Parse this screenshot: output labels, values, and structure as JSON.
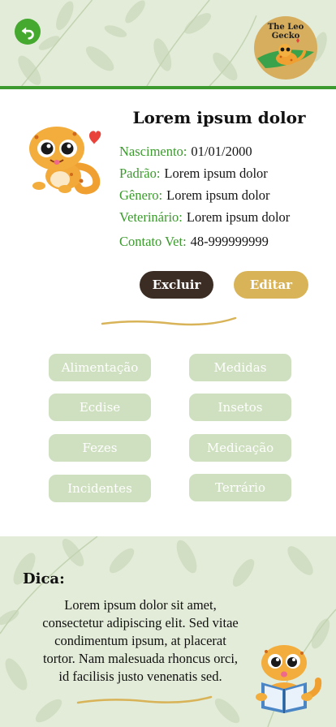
{
  "header": {
    "back_icon": "back-arrow-icon",
    "logo_text": "The Leo Gecko",
    "colors": {
      "header_bg": "#e3ecd8",
      "accent_green": "#3c9a2e",
      "logo_gold": "#d6ae5e"
    }
  },
  "profile": {
    "avatar_icon": "gecko-heart-icon",
    "name": "Lorem ipsum dolor",
    "fields": [
      {
        "label": "Nascimento:",
        "value": "01/01/2000"
      },
      {
        "label": "Padrão:",
        "value": "Lorem ipsum dolor"
      },
      {
        "label": "Gênero:",
        "value": "Lorem ipsum dolor"
      },
      {
        "label": "Veterinário:",
        "value": "Lorem ipsum dolor"
      },
      {
        "label": "Contato Vet:",
        "value": "48-999999999"
      }
    ]
  },
  "actions": {
    "delete_label": "Excluir",
    "edit_label": "Editar",
    "colors": {
      "delete_bg": "#3b2c24",
      "edit_bg": "#d8b358"
    }
  },
  "menu": {
    "items": [
      {
        "label": "Alimentação"
      },
      {
        "label": "Medidas"
      },
      {
        "label": "Ecdise"
      },
      {
        "label": "Insetos"
      },
      {
        "label": "Fezes"
      },
      {
        "label": "Medicação"
      },
      {
        "label": "Incidentes"
      },
      {
        "label": "Terrário"
      }
    ],
    "colors": {
      "button_bg": "#cfe0c0",
      "button_text": "#ffffff"
    }
  },
  "tip": {
    "title": "Dica:",
    "lines": [
      "Lorem ipsum dolor sit amet,",
      "consectetur adipiscing elit. Sed vitae",
      "condimentum ipsum, at placerat",
      "tortor. Nam malesuada rhoncus orci,",
      "id facilisis justo venenatis sed."
    ],
    "illustration_icon": "gecko-reading-book-icon"
  }
}
